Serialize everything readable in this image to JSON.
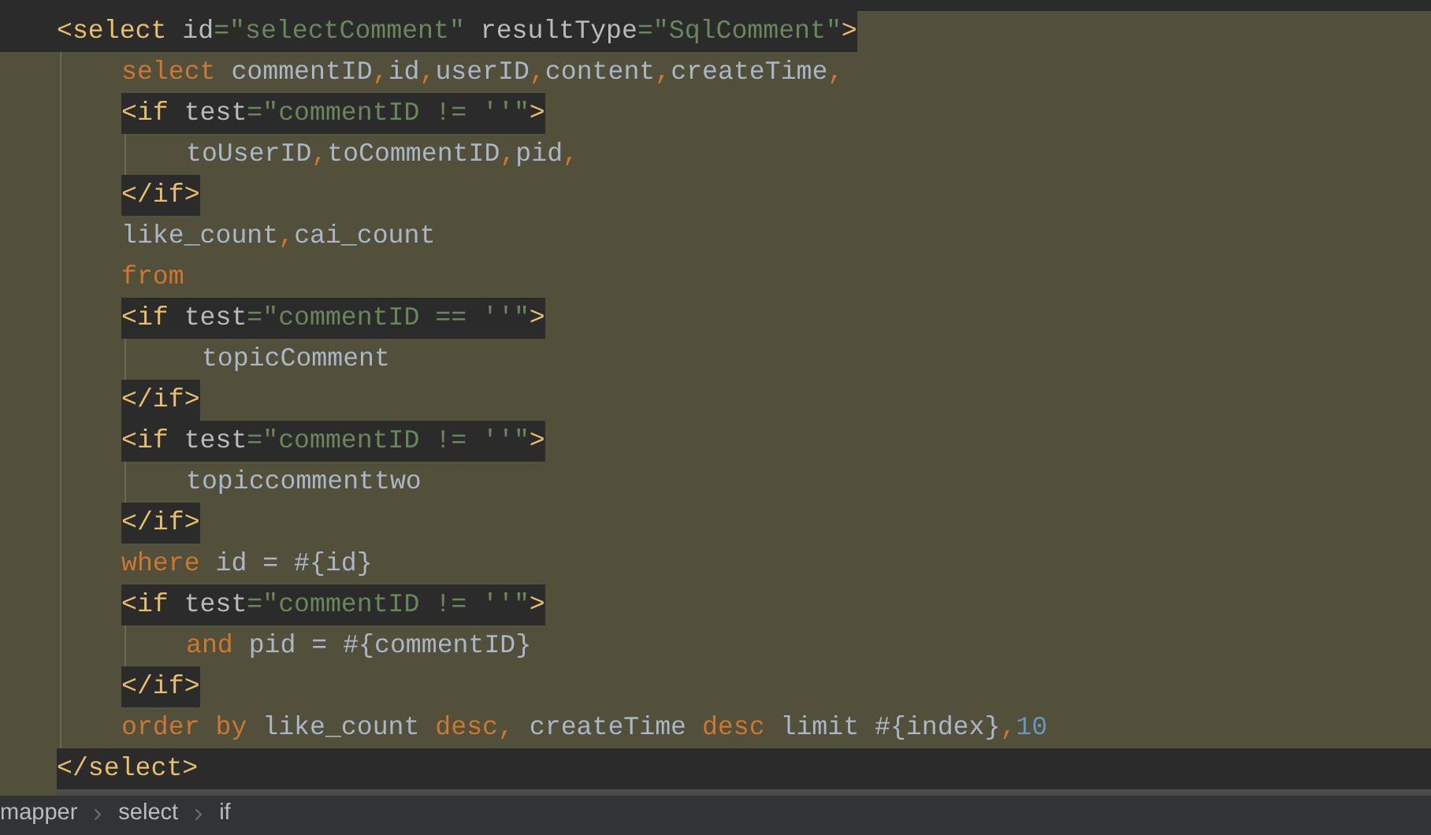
{
  "editor": {
    "lines": [
      {
        "kind": "outer-tag",
        "tokens": [
          {
            "text": "<select",
            "color": "#e8bf6a"
          },
          {
            "text": " id",
            "color": "#bababa"
          },
          {
            "text": "=\"selectComment\"",
            "color": "#6a8759"
          },
          {
            "text": " resultType",
            "color": "#bababa"
          },
          {
            "text": "=\"SqlComment\"",
            "color": "#6a8759"
          },
          {
            "text": ">",
            "color": "#e8bf6a"
          }
        ],
        "children": [
          {
            "kind": "code",
            "tokens": [
              {
                "text": "select",
                "color": "#cc7832"
              },
              {
                "text": " commentID",
                "color": "#a9b7c6"
              },
              {
                "text": ",",
                "color": "#cc7832"
              },
              {
                "text": "id",
                "color": "#a9b7c6"
              },
              {
                "text": ",",
                "color": "#cc7832"
              },
              {
                "text": "userID",
                "color": "#a9b7c6"
              },
              {
                "text": ",",
                "color": "#cc7832"
              },
              {
                "text": "content",
                "color": "#a9b7c6"
              },
              {
                "text": ",",
                "color": "#cc7832"
              },
              {
                "text": "createTime",
                "color": "#a9b7c6"
              },
              {
                "text": ",",
                "color": "#cc7832"
              }
            ]
          },
          {
            "kind": "tag",
            "tokens": [
              {
                "text": "<if",
                "color": "#e8bf6a"
              },
              {
                "text": " test",
                "color": "#bababa"
              },
              {
                "text": "=\"commentID != ''\"",
                "color": "#6a8759"
              },
              {
                "text": ">",
                "color": "#e8bf6a"
              }
            ],
            "children": [
              {
                "kind": "code",
                "tokens": [
                  {
                    "text": "toUserID",
                    "color": "#a9b7c6"
                  },
                  {
                    "text": ",",
                    "color": "#cc7832"
                  },
                  {
                    "text": "toCommentID",
                    "color": "#a9b7c6"
                  },
                  {
                    "text": ",",
                    "color": "#cc7832"
                  },
                  {
                    "text": "pid",
                    "color": "#a9b7c6"
                  },
                  {
                    "text": ",",
                    "color": "#cc7832"
                  }
                ]
              }
            ]
          },
          {
            "kind": "tag",
            "tokens": [
              {
                "text": "</if>",
                "color": "#e8bf6a"
              }
            ]
          },
          {
            "kind": "code",
            "tokens": [
              {
                "text": "like_count",
                "color": "#a9b7c6"
              },
              {
                "text": ",",
                "color": "#cc7832"
              },
              {
                "text": "cai_count",
                "color": "#a9b7c6"
              }
            ]
          },
          {
            "kind": "code",
            "tokens": [
              {
                "text": "from",
                "color": "#cc7832"
              }
            ]
          },
          {
            "kind": "tag",
            "tokens": [
              {
                "text": "<if",
                "color": "#e8bf6a"
              },
              {
                "text": " test",
                "color": "#bababa"
              },
              {
                "text": "=\"commentID == ''\"",
                "color": "#6a8759"
              },
              {
                "text": ">",
                "color": "#e8bf6a"
              }
            ],
            "children": [
              {
                "kind": "code",
                "tokens": [
                  {
                    "text": " topicComment",
                    "color": "#a9b7c6"
                  }
                ]
              }
            ]
          },
          {
            "kind": "tag",
            "tokens": [
              {
                "text": "</if>",
                "color": "#e8bf6a"
              }
            ]
          },
          {
            "kind": "tag",
            "tokens": [
              {
                "text": "<if",
                "color": "#e8bf6a"
              },
              {
                "text": " test",
                "color": "#bababa"
              },
              {
                "text": "=\"commentID != ''\"",
                "color": "#6a8759"
              },
              {
                "text": ">",
                "color": "#e8bf6a"
              }
            ],
            "children": [
              {
                "kind": "code",
                "tokens": [
                  {
                    "text": "topiccommenttwo",
                    "color": "#a9b7c6"
                  }
                ]
              }
            ]
          },
          {
            "kind": "tag",
            "tokens": [
              {
                "text": "</if>",
                "color": "#e8bf6a"
              }
            ]
          },
          {
            "kind": "code",
            "tokens": [
              {
                "text": "where",
                "color": "#cc7832"
              },
              {
                "text": " id = #{id}",
                "color": "#a9b7c6"
              }
            ]
          },
          {
            "kind": "tag",
            "tokens": [
              {
                "text": "<if",
                "color": "#e8bf6a"
              },
              {
                "text": " test",
                "color": "#bababa"
              },
              {
                "text": "=\"commentID != ''\"",
                "color": "#6a8759"
              },
              {
                "text": ">",
                "color": "#e8bf6a"
              }
            ],
            "children": [
              {
                "kind": "code",
                "tokens": [
                  {
                    "text": "and",
                    "color": "#cc7832"
                  },
                  {
                    "text": " pid = #{commentID}",
                    "color": "#a9b7c6"
                  }
                ]
              }
            ]
          },
          {
            "kind": "tag",
            "tokens": [
              {
                "text": "</if>",
                "color": "#e8bf6a"
              }
            ]
          },
          {
            "kind": "code",
            "tokens": [
              {
                "text": "order by",
                "color": "#cc7832"
              },
              {
                "text": " like_count ",
                "color": "#a9b7c6"
              },
              {
                "text": "desc,",
                "color": "#cc7832"
              },
              {
                "text": " createTime ",
                "color": "#a9b7c6"
              },
              {
                "text": "desc",
                "color": "#cc7832"
              },
              {
                "text": " limit #{index}",
                "color": "#a9b7c6"
              },
              {
                "text": ",",
                "color": "#cc7832"
              },
              {
                "text": "10",
                "color": "#6897bb"
              }
            ]
          }
        ]
      },
      {
        "kind": "caret-line",
        "tokens": [
          {
            "text": "</select>",
            "color": "#e8bf6a"
          }
        ]
      }
    ]
  },
  "breadcrumbs": [
    {
      "label": "mapper"
    },
    {
      "label": "select"
    },
    {
      "label": "if"
    }
  ]
}
